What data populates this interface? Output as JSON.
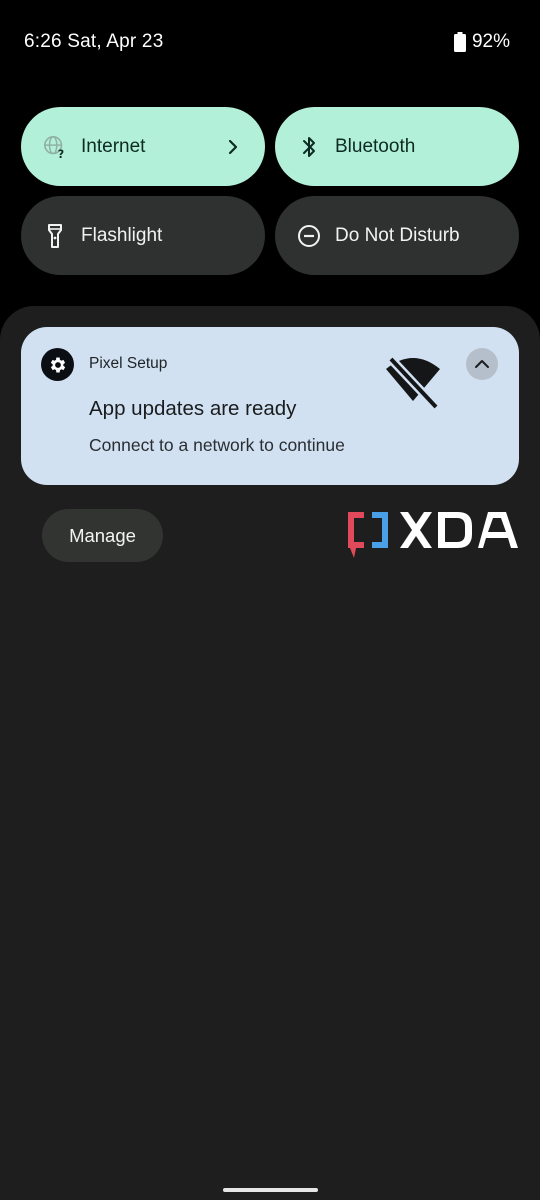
{
  "status_bar": {
    "time_date": "6:26 Sat, Apr 23",
    "battery_percent": "92%",
    "battery_icon": "battery-icon"
  },
  "quick_settings": {
    "tiles": [
      {
        "label": "Internet",
        "icon": "internet-unknown-icon",
        "state": "on",
        "has_chevron": true
      },
      {
        "label": "Bluetooth",
        "icon": "bluetooth-icon",
        "state": "on"
      },
      {
        "label": "Flashlight",
        "icon": "flashlight-icon",
        "state": "off"
      },
      {
        "label": "Do Not Disturb",
        "icon": "do-not-disturb-icon",
        "state": "off"
      }
    ],
    "colors": {
      "active_tile": "#b3f0da",
      "inactive_tile": "#2f3130"
    }
  },
  "notification": {
    "app_name": "Pixel Setup",
    "app_icon": "gear-icon",
    "title": "App updates are ready",
    "text": "Connect to a network to continue",
    "large_icon": "wifi-off-icon",
    "expand_icon": "chevron-up-icon",
    "background": "#d1e1f2"
  },
  "actions": {
    "manage_label": "Manage"
  },
  "watermark": {
    "text": "XDA",
    "bracket_colors": [
      "#e04a5a",
      "#4aa0e6"
    ]
  }
}
